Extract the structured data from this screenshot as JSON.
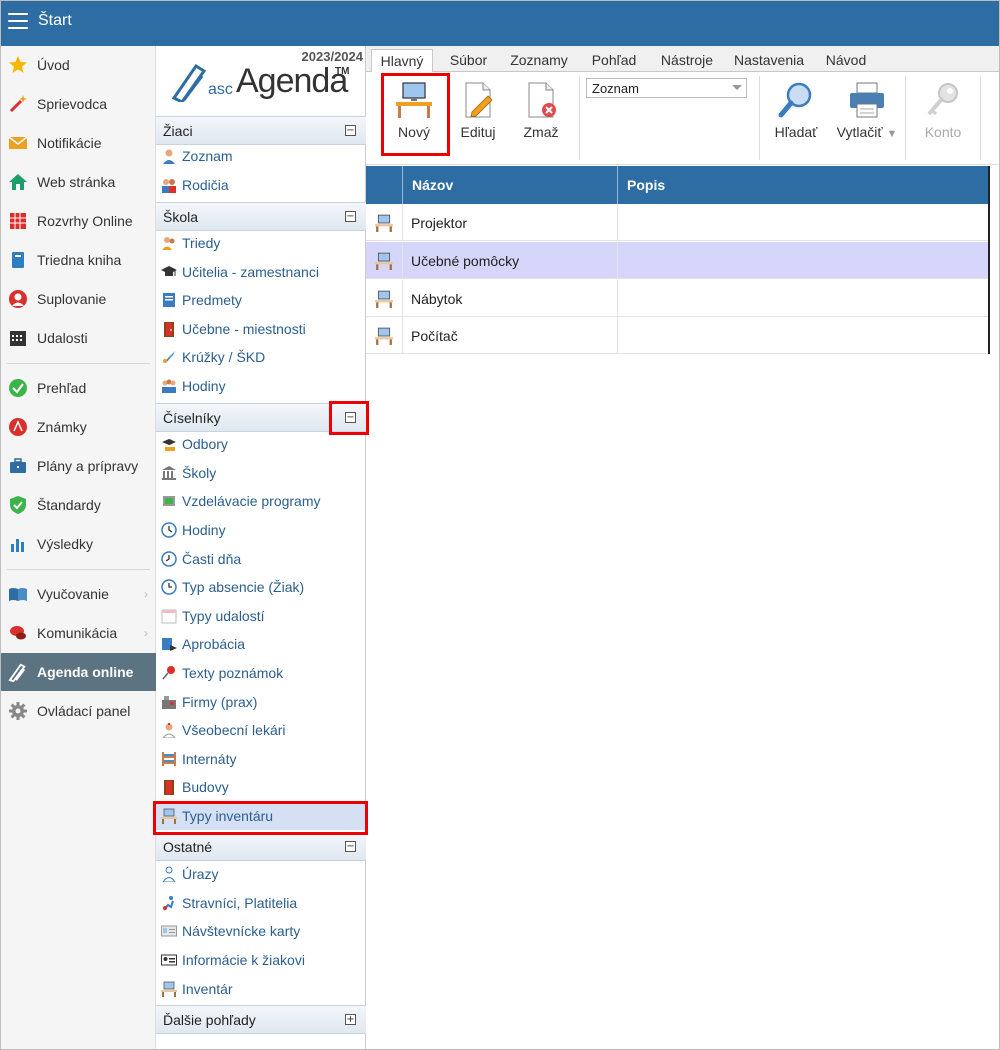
{
  "topbar": {
    "title": "Štart"
  },
  "leftnav": [
    {
      "label": "Úvod",
      "icon": "star-icon",
      "color": "#f5b800"
    },
    {
      "label": "Sprievodca",
      "icon": "magic-wand-icon",
      "color": "#d9302c"
    },
    {
      "label": "Notifikácie",
      "icon": "envelope-icon",
      "color": "#f0a020"
    },
    {
      "label": "Web stránka",
      "icon": "house-icon",
      "color": "#1e9e6a"
    },
    {
      "label": "Rozvrhy Online",
      "icon": "timetable-icon",
      "color": "#d9302c"
    },
    {
      "label": "Triedna kniha",
      "icon": "book-icon",
      "color": "#2d7fc1"
    },
    {
      "label": "Suplovanie",
      "icon": "person-icon",
      "color": "#d9302c"
    },
    {
      "label": "Udalosti",
      "icon": "calendar-icon",
      "color": "#333333"
    },
    {
      "label": "Prehľad",
      "icon": "check-circle-icon",
      "color": "#3cb44b"
    },
    {
      "label": "Známky",
      "icon": "grade-circle-icon",
      "color": "#d9302c"
    },
    {
      "label": "Plány a prípravy",
      "icon": "briefcase-icon",
      "color": "#2d6da3"
    },
    {
      "label": "Štandardy",
      "icon": "shield-check-icon",
      "color": "#3cb44b"
    },
    {
      "label": "Výsledky",
      "icon": "bar-chart-icon",
      "color": "#2d7fc1"
    },
    {
      "label": "Vyučovanie",
      "icon": "open-book-icon",
      "color": "#2d6da3"
    },
    {
      "label": "Komunikácia",
      "icon": "chat-icon",
      "color": "#d9302c"
    },
    {
      "label": "Agenda online",
      "icon": "agenda-logo-icon",
      "color": "#ffffff"
    },
    {
      "label": "Ovládací panel",
      "icon": "gear-icon",
      "color": "#888888"
    }
  ],
  "logo": {
    "year": "2023/2024",
    "asc": "asc",
    "agenda": "Agenda",
    "tm": "TM"
  },
  "sections": {
    "ziaci": {
      "title": "Žiaci",
      "items": [
        "Zoznam",
        "Rodičia"
      ]
    },
    "skola": {
      "title": "Škola",
      "items": [
        "Triedy",
        "Učitelia - zamestnanci",
        "Predmety",
        "Učebne - miestnosti",
        "Krúžky / ŠKD",
        "Hodiny"
      ]
    },
    "ciselniky": {
      "title": "Číselníky",
      "items": [
        "Odbory",
        "Školy",
        "Vzdelávacie programy",
        "Hodiny",
        "Časti dňa",
        "Typ absencie (Žiak)",
        "Typy udalostí",
        "Aprobácia",
        "Texty poznámok",
        "Firmy (prax)",
        "Všeobecní lekári",
        "Internáty",
        "Budovy",
        "Typy inventáru"
      ]
    },
    "ostatne": {
      "title": "Ostatné",
      "items": [
        "Úrazy",
        "Stravníci, Platitelia",
        "Návštevnícke karty",
        "Informácie k žiakovi",
        "Inventár"
      ]
    },
    "dalsie": {
      "title": "Ďalšie pohľady"
    }
  },
  "tabs": [
    "Hlavný",
    "Súbor",
    "Zoznamy",
    "Pohľad",
    "Nástroje",
    "Nastavenia",
    "Návod"
  ],
  "ribbon": {
    "novy": "Nový",
    "edituj": "Edituj",
    "zmaz": "Zmaž",
    "view_select": "Zoznam",
    "hladat": "Hľadať",
    "vytlacit": "Vytlačiť",
    "konto": "Konto"
  },
  "table": {
    "columns": [
      "Názov",
      "Popis"
    ],
    "rows": [
      {
        "nazov": "Projektor",
        "popis": ""
      },
      {
        "nazov": "Učebné pomôcky",
        "popis": ""
      },
      {
        "nazov": "Nábytok",
        "popis": ""
      },
      {
        "nazov": "Počítač",
        "popis": ""
      }
    ]
  }
}
